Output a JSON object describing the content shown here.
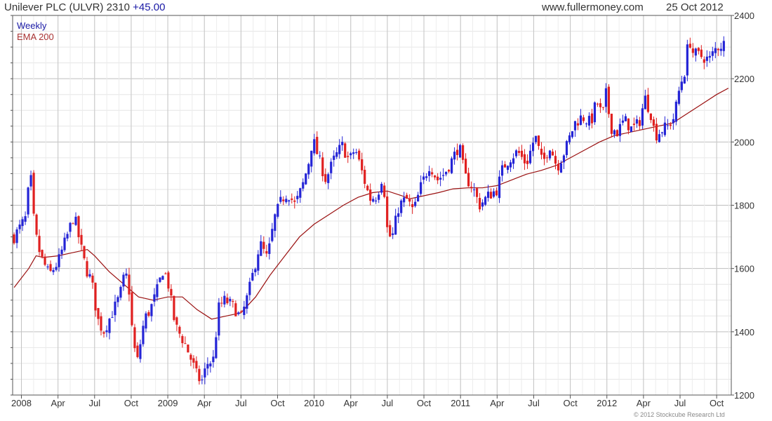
{
  "header": {
    "title": "Unilever PLC (ULVR) 2310",
    "change": "+45.00",
    "site": "www.fullermoney.com",
    "date": "25 Oct 2012"
  },
  "legend": {
    "period": "Weekly",
    "indicator": "EMA 200"
  },
  "copyright": "© 2012 Stockcube Research Ltd",
  "colors": {
    "up": "#2424d6",
    "down": "#e02020",
    "ema": "#9a1010",
    "grid": "#c8c8c8",
    "axis": "#555555"
  },
  "chart_data": {
    "type": "candlestick",
    "period": "Weekly",
    "ylim": [
      1200,
      2400
    ],
    "yticks": [
      1200,
      1400,
      1600,
      1800,
      2000,
      2200,
      2400
    ],
    "x_range": [
      2007.94,
      2012.85
    ],
    "x_ticks": [
      {
        "label": "2008",
        "t": 2008.0
      },
      {
        "label": "Apr",
        "t": 2008.25
      },
      {
        "label": "Jul",
        "t": 2008.5
      },
      {
        "label": "Oct",
        "t": 2008.75
      },
      {
        "label": "2009",
        "t": 2009.0
      },
      {
        "label": "Apr",
        "t": 2009.25
      },
      {
        "label": "Jul",
        "t": 2009.5
      },
      {
        "label": "Oct",
        "t": 2009.75
      },
      {
        "label": "2010",
        "t": 2010.0
      },
      {
        "label": "Apr",
        "t": 2010.25
      },
      {
        "label": "Jul",
        "t": 2010.5
      },
      {
        "label": "Oct",
        "t": 2010.75
      },
      {
        "label": "2011",
        "t": 2011.0
      },
      {
        "label": "Apr",
        "t": 2011.25
      },
      {
        "label": "Jul",
        "t": 2011.5
      },
      {
        "label": "Oct",
        "t": 2011.75
      },
      {
        "label": "2012",
        "t": 2012.0
      },
      {
        "label": "Apr",
        "t": 2012.25
      },
      {
        "label": "Jul",
        "t": 2012.5
      },
      {
        "label": "Oct",
        "t": 2012.75
      }
    ],
    "price_path": [
      [
        2007.95,
        1700
      ],
      [
        2008.03,
        1760
      ],
      [
        2008.06,
        1910
      ],
      [
        2008.09,
        1720
      ],
      [
        2008.13,
        1640
      ],
      [
        2008.19,
        1580
      ],
      [
        2008.25,
        1620
      ],
      [
        2008.31,
        1700
      ],
      [
        2008.36,
        1770
      ],
      [
        2008.4,
        1680
      ],
      [
        2008.44,
        1600
      ],
      [
        2008.48,
        1560
      ],
      [
        2008.52,
        1440
      ],
      [
        2008.56,
        1400
      ],
      [
        2008.62,
        1460
      ],
      [
        2008.67,
        1510
      ],
      [
        2008.71,
        1590
      ],
      [
        2008.74,
        1520
      ],
      [
        2008.76,
        1380
      ],
      [
        2008.79,
        1300
      ],
      [
        2008.84,
        1440
      ],
      [
        2008.88,
        1470
      ],
      [
        2008.92,
        1520
      ],
      [
        2008.97,
        1600
      ],
      [
        2009.0,
        1560
      ],
      [
        2009.05,
        1420
      ],
      [
        2009.12,
        1360
      ],
      [
        2009.17,
        1300
      ],
      [
        2009.2,
        1260
      ],
      [
        2009.23,
        1240
      ],
      [
        2009.27,
        1300
      ],
      [
        2009.31,
        1310
      ],
      [
        2009.35,
        1480
      ],
      [
        2009.39,
        1500
      ],
      [
        2009.45,
        1480
      ],
      [
        2009.5,
        1440
      ],
      [
        2009.55,
        1520
      ],
      [
        2009.59,
        1600
      ],
      [
        2009.63,
        1680
      ],
      [
        2009.68,
        1630
      ],
      [
        2009.73,
        1760
      ],
      [
        2009.78,
        1820
      ],
      [
        2009.82,
        1840
      ],
      [
        2009.87,
        1800
      ],
      [
        2009.92,
        1860
      ],
      [
        2009.96,
        1930
      ],
      [
        2009.99,
        2010
      ],
      [
        2010.03,
        1950
      ],
      [
        2010.08,
        1880
      ],
      [
        2010.13,
        1940
      ],
      [
        2010.19,
        1990
      ],
      [
        2010.24,
        1940
      ],
      [
        2010.28,
        1980
      ],
      [
        2010.33,
        1900
      ],
      [
        2010.38,
        1820
      ],
      [
        2010.43,
        1830
      ],
      [
        2010.47,
        1900
      ],
      [
        2010.5,
        1720
      ],
      [
        2010.53,
        1690
      ],
      [
        2010.58,
        1800
      ],
      [
        2010.63,
        1820
      ],
      [
        2010.68,
        1780
      ],
      [
        2010.73,
        1860
      ],
      [
        2010.79,
        1930
      ],
      [
        2010.84,
        1880
      ],
      [
        2010.89,
        1900
      ],
      [
        2010.95,
        1950
      ],
      [
        2010.99,
        1990
      ],
      [
        2011.03,
        1890
      ],
      [
        2011.08,
        1860
      ],
      [
        2011.13,
        1800
      ],
      [
        2011.19,
        1830
      ],
      [
        2011.25,
        1850
      ],
      [
        2011.29,
        1920
      ],
      [
        2011.34,
        1950
      ],
      [
        2011.39,
        1970
      ],
      [
        2011.45,
        1930
      ],
      [
        2011.51,
        2020
      ],
      [
        2011.56,
        1930
      ],
      [
        2011.61,
        1990
      ],
      [
        2011.66,
        1920
      ],
      [
        2011.72,
        1980
      ],
      [
        2011.78,
        2060
      ],
      [
        2011.83,
        2080
      ],
      [
        2011.89,
        2060
      ],
      [
        2011.93,
        2130
      ],
      [
        2011.97,
        2080
      ],
      [
        2012.0,
        2170
      ],
      [
        2012.02,
        2050
      ],
      [
        2012.07,
        2030
      ],
      [
        2012.12,
        2070
      ],
      [
        2012.17,
        2040
      ],
      [
        2012.22,
        2060
      ],
      [
        2012.26,
        2140
      ],
      [
        2012.3,
        2090
      ],
      [
        2012.33,
        2020
      ],
      [
        2012.38,
        2040
      ],
      [
        2012.42,
        2050
      ],
      [
        2012.46,
        2080
      ],
      [
        2012.5,
        2180
      ],
      [
        2012.53,
        2220
      ],
      [
        2012.56,
        2330
      ],
      [
        2012.59,
        2280
      ],
      [
        2012.65,
        2270
      ],
      [
        2012.7,
        2260
      ],
      [
        2012.75,
        2300
      ],
      [
        2012.8,
        2310
      ]
    ],
    "ema_200": [
      [
        2007.95,
        1540
      ],
      [
        2008.05,
        1600
      ],
      [
        2008.1,
        1640
      ],
      [
        2008.15,
        1635
      ],
      [
        2008.25,
        1640
      ],
      [
        2008.35,
        1650
      ],
      [
        2008.45,
        1660
      ],
      [
        2008.5,
        1640
      ],
      [
        2008.6,
        1590
      ],
      [
        2008.7,
        1550
      ],
      [
        2008.8,
        1510
      ],
      [
        2008.9,
        1500
      ],
      [
        2009.0,
        1510
      ],
      [
        2009.1,
        1510
      ],
      [
        2009.2,
        1470
      ],
      [
        2009.3,
        1440
      ],
      [
        2009.4,
        1450
      ],
      [
        2009.5,
        1460
      ],
      [
        2009.6,
        1510
      ],
      [
        2009.7,
        1580
      ],
      [
        2009.8,
        1640
      ],
      [
        2009.9,
        1700
      ],
      [
        2010.0,
        1740
      ],
      [
        2010.1,
        1770
      ],
      [
        2010.2,
        1800
      ],
      [
        2010.3,
        1825
      ],
      [
        2010.4,
        1840
      ],
      [
        2010.5,
        1845
      ],
      [
        2010.6,
        1830
      ],
      [
        2010.65,
        1820
      ],
      [
        2010.75,
        1830
      ],
      [
        2010.85,
        1840
      ],
      [
        2010.95,
        1852
      ],
      [
        2011.05,
        1855
      ],
      [
        2011.15,
        1855
      ],
      [
        2011.25,
        1862
      ],
      [
        2011.35,
        1880
      ],
      [
        2011.45,
        1898
      ],
      [
        2011.55,
        1910
      ],
      [
        2011.65,
        1925
      ],
      [
        2011.75,
        1950
      ],
      [
        2011.85,
        1975
      ],
      [
        2011.95,
        2000
      ],
      [
        2012.05,
        2020
      ],
      [
        2012.15,
        2030
      ],
      [
        2012.25,
        2040
      ],
      [
        2012.35,
        2050
      ],
      [
        2012.45,
        2060
      ],
      [
        2012.55,
        2090
      ],
      [
        2012.65,
        2120
      ],
      [
        2012.75,
        2150
      ],
      [
        2012.83,
        2170
      ]
    ]
  }
}
